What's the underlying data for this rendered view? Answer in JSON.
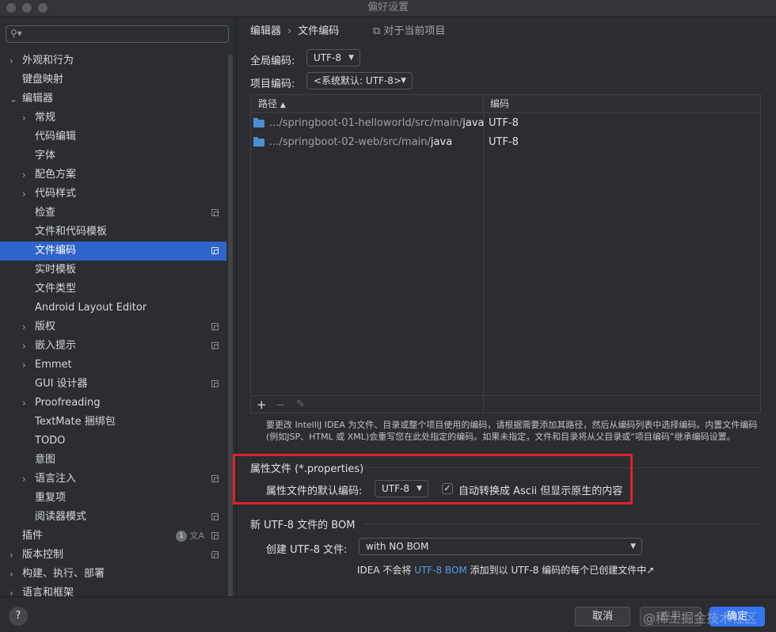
{
  "window": {
    "title": "偏好设置"
  },
  "sidebar": {
    "search_placeholder": "",
    "items": [
      {
        "label": "外观和行为",
        "chevron": "›",
        "level": 0,
        "expanded": false,
        "badge": false
      },
      {
        "label": "键盘映射",
        "chevron": "",
        "level": 0,
        "badge": false
      },
      {
        "label": "编辑器",
        "chevron": "⌄",
        "level": 0,
        "expanded": true,
        "badge": false
      },
      {
        "label": "常规",
        "chevron": "›",
        "level": 1,
        "badge": false
      },
      {
        "label": "代码编辑",
        "chevron": "",
        "level": 1,
        "badge": false
      },
      {
        "label": "字体",
        "chevron": "",
        "level": 1,
        "badge": false
      },
      {
        "label": "配色方案",
        "chevron": "›",
        "level": 1,
        "badge": false
      },
      {
        "label": "代码样式",
        "chevron": "›",
        "level": 1,
        "badge": false
      },
      {
        "label": "检查",
        "chevron": "",
        "level": 1,
        "badge": true
      },
      {
        "label": "文件和代码模板",
        "chevron": "",
        "level": 1,
        "badge": false
      },
      {
        "label": "文件编码",
        "chevron": "",
        "level": 1,
        "badge": true,
        "selected": true
      },
      {
        "label": "实时模板",
        "chevron": "",
        "level": 1,
        "badge": false
      },
      {
        "label": "文件类型",
        "chevron": "",
        "level": 1,
        "badge": false
      },
      {
        "label": "Android Layout Editor",
        "chevron": "",
        "level": 1,
        "badge": false
      },
      {
        "label": "版权",
        "chevron": "›",
        "level": 1,
        "badge": true
      },
      {
        "label": "嵌入提示",
        "chevron": "›",
        "level": 1,
        "badge": true
      },
      {
        "label": "Emmet",
        "chevron": "›",
        "level": 1,
        "badge": false
      },
      {
        "label": "GUI 设计器",
        "chevron": "",
        "level": 1,
        "badge": true
      },
      {
        "label": "Proofreading",
        "chevron": "›",
        "level": 1,
        "badge": false
      },
      {
        "label": "TextMate 捆绑包",
        "chevron": "",
        "level": 1,
        "badge": false
      },
      {
        "label": "TODO",
        "chevron": "",
        "level": 1,
        "badge": false
      },
      {
        "label": "意图",
        "chevron": "",
        "level": 1,
        "badge": false
      },
      {
        "label": "语言注入",
        "chevron": "›",
        "level": 1,
        "badge": true
      },
      {
        "label": "重复项",
        "chevron": "",
        "level": 1,
        "badge": false
      },
      {
        "label": "阅读器模式",
        "chevron": "",
        "level": 1,
        "badge": true
      },
      {
        "label": "插件",
        "chevron": "",
        "level": 0,
        "badge": true,
        "count": "1"
      },
      {
        "label": "版本控制",
        "chevron": "›",
        "level": 0,
        "badge": true
      },
      {
        "label": "构建、执行、部署",
        "chevron": "›",
        "level": 0,
        "badge": false
      },
      {
        "label": "语言和框架",
        "chevron": "›",
        "level": 0,
        "badge": false
      }
    ]
  },
  "breadcrumb": {
    "parent": "编辑器",
    "separator": "›",
    "current": "文件编码",
    "scope": "对于当前项目"
  },
  "encoding": {
    "global_label": "全局编码:",
    "global_value": "UTF-8",
    "project_label": "项目编码:",
    "project_value": "<系统默认: UTF-8>"
  },
  "table": {
    "headers": {
      "path": "路径",
      "sort": "▲",
      "encoding": "编码"
    },
    "rows": [
      {
        "path_dim": ".../springboot-01-helloworld/src/main/",
        "path_bold": "java",
        "encoding": "UTF-8"
      },
      {
        "path_dim": ".../springboot-02-web/src/main/",
        "path_bold": "java",
        "encoding": "UTF-8"
      }
    ],
    "toolbar": {
      "add": "+",
      "remove": "−",
      "edit": "✎"
    }
  },
  "hint": "要更改 IntelliJ IDEA 为文件、目录或整个项目使用的编码，请根据需要添加其路径，然后从编码列表中选择编码。内置文件编码(例如JSP、HTML 或 XML)会重写您在此处指定的编码。如果未指定，文件和目录将从父目录或“项目编码”继承编码设置。",
  "properties": {
    "title": "属性文件 (*.properties)",
    "default_label": "属性文件的默认编码:",
    "default_value": "UTF-8",
    "ascii_label": "自动转换成 Ascii 但显示原生的内容",
    "ascii_checked": "✓"
  },
  "bom": {
    "title": "新 UTF-8 文件的 BOM",
    "create_label": "创建 UTF-8 文件:",
    "create_value": "with NO BOM",
    "note_prefix": "IDEA 不会将 ",
    "note_link": "UTF-8 BOM",
    "note_suffix": " 添加到以 UTF-8 编码的每个已创建文件中↗"
  },
  "buttons": {
    "help": "?",
    "cancel": "取消",
    "apply": "应用",
    "ok": "确定"
  },
  "watermark": "@稀土掘金技术社区",
  "colors": {
    "selected": "#2f65ca",
    "primary_button": "#3574f0",
    "highlight_box": "#e0202a",
    "link": "#5b97e5",
    "folder": "#4a8fcf"
  }
}
